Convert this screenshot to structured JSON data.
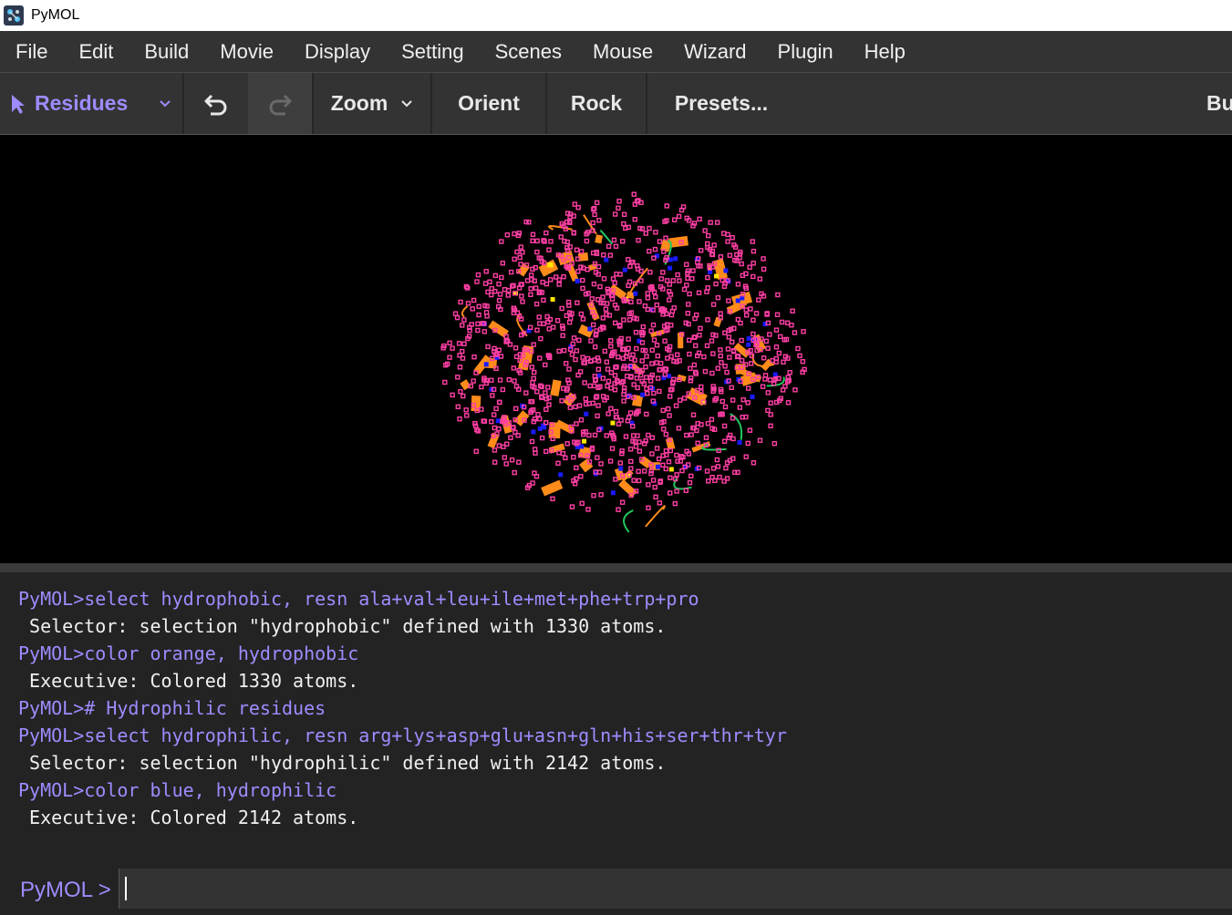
{
  "window": {
    "title": "PyMOL"
  },
  "menu": [
    "File",
    "Edit",
    "Build",
    "Movie",
    "Display",
    "Setting",
    "Scenes",
    "Mouse",
    "Wizard",
    "Plugin",
    "Help"
  ],
  "toolbar": {
    "mode_label": "Residues",
    "zoom_label": "Zoom",
    "orient_label": "Orient",
    "rock_label": "Rock",
    "presets_label": "Presets...",
    "builder_label": "Bu"
  },
  "icons": {
    "mode": "cursor-arrow-icon",
    "undo": "undo-icon",
    "redo": "redo-icon",
    "dropdown": "chevron-down-icon"
  },
  "colors": {
    "accent": "#9f8bff",
    "atoms": "#ff3fa4",
    "hydrophobic": "#ff8c1a",
    "hydrophilic": "#1a1aff"
  },
  "console": [
    {
      "type": "cmd",
      "text": "PyMOL>select hydrophobic, resn ala+val+leu+ile+met+phe+trp+pro"
    },
    {
      "type": "out",
      "text": " Selector: selection \"hydrophobic\" defined with 1330 atoms."
    },
    {
      "type": "cmd",
      "text": "PyMOL>color orange, hydrophobic"
    },
    {
      "type": "out",
      "text": " Executive: Colored 1330 atoms."
    },
    {
      "type": "cmd",
      "text": "PyMOL># Hydrophilic residues"
    },
    {
      "type": "cmd",
      "text": "PyMOL>select hydrophilic, resn arg+lys+asp+glu+asn+gln+his+ser+thr+tyr"
    },
    {
      "type": "out",
      "text": " Selector: selection \"hydrophilic\" defined with 2142 atoms."
    },
    {
      "type": "cmd",
      "text": "PyMOL>color blue, hydrophilic"
    },
    {
      "type": "out",
      "text": " Executive: Colored 2142 atoms."
    }
  ],
  "command_line": {
    "prompt": "PyMOL >",
    "value": ""
  }
}
